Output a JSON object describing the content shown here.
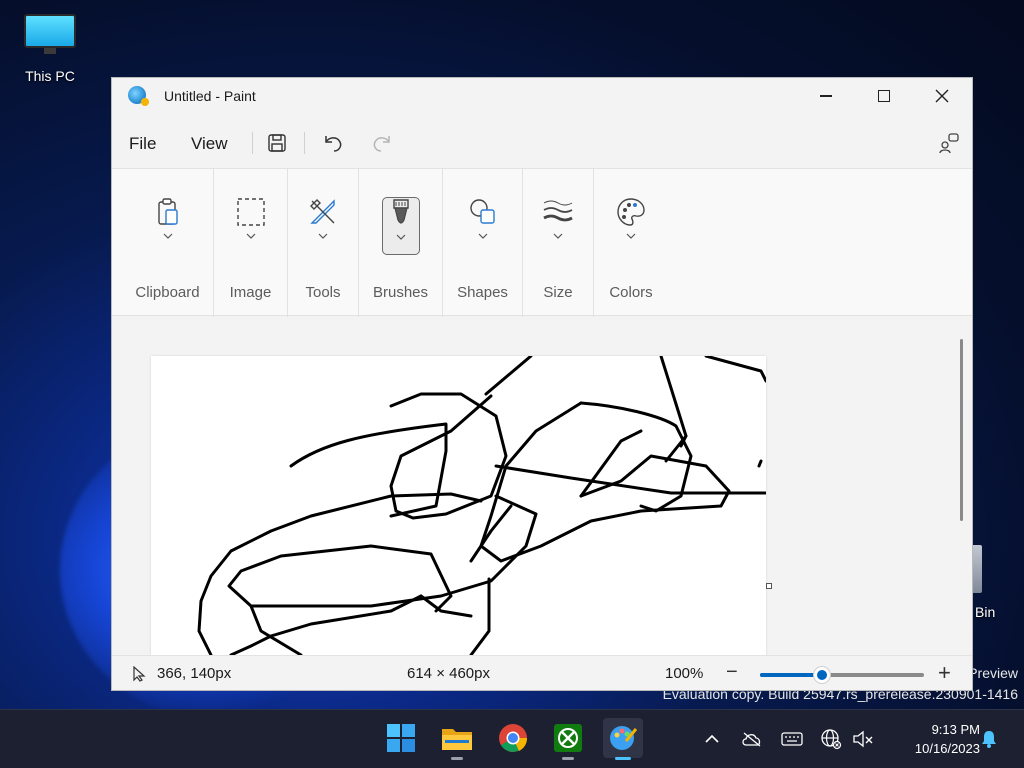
{
  "desktop": {
    "this_pc_label": "This PC",
    "recycle_label": "Bin",
    "watermark_line1": "Preview",
    "watermark_line2": "Evaluation copy. Build 25947.rs_prerelease.230901-1416"
  },
  "window": {
    "title": "Untitled - Paint",
    "app_icon": "paint-palette-icon"
  },
  "menubar": {
    "file": "File",
    "view": "View",
    "save_icon": "save-icon",
    "undo_icon": "undo-icon",
    "redo_icon": "redo-icon",
    "profile_icon": "account-icon"
  },
  "ribbon": {
    "groups": [
      {
        "label": "Clipboard",
        "icon": "clipboard-icon"
      },
      {
        "label": "Image",
        "icon": "select-icon"
      },
      {
        "label": "Tools",
        "icon": "tools-icon"
      },
      {
        "label": "Brushes",
        "icon": "brush-icon",
        "selected": true
      },
      {
        "label": "Shapes",
        "icon": "shapes-icon"
      },
      {
        "label": "Size",
        "icon": "size-icon"
      },
      {
        "label": "Colors",
        "icon": "palette-icon"
      }
    ]
  },
  "status": {
    "cursor_position": "366, 140px",
    "canvas_size": "614 × 460px",
    "zoom": "100%",
    "zoom_fraction": 0.38
  },
  "taskbar": {
    "apps": [
      {
        "name": "start",
        "icon": "windows-start-icon"
      },
      {
        "name": "file-explorer",
        "icon": "folder-icon"
      },
      {
        "name": "chrome",
        "icon": "chrome-icon"
      },
      {
        "name": "xbox",
        "icon": "xbox-icon"
      },
      {
        "name": "paint",
        "icon": "paint-icon",
        "active": true
      }
    ],
    "time": "9:13 PM",
    "date": "10/16/2023"
  },
  "colors": {
    "accent": "#0067c0",
    "taskbar": "#1c2030"
  }
}
